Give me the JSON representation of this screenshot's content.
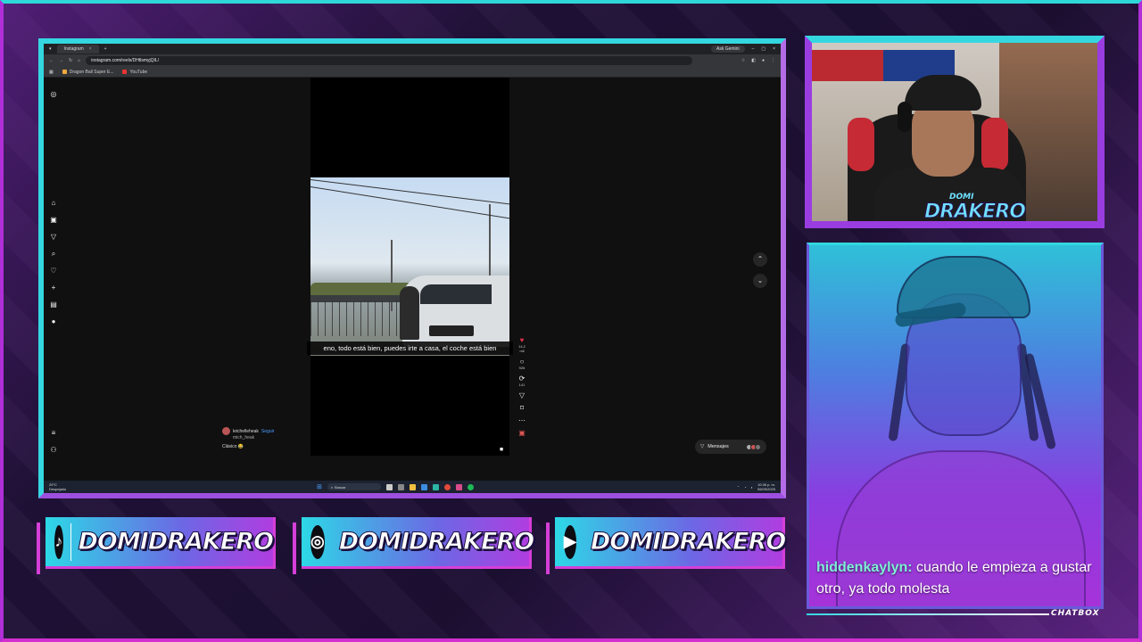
{
  "browser": {
    "tab_title": "Instagram",
    "ask_gemini": "Ask Gemini",
    "url": "instagram.com/reels/DHtlsmyjQIL/",
    "bookmarks": [
      "Dragon Ball Super E...",
      "YouTube"
    ]
  },
  "reel": {
    "subtitle": "eno, todo está bien, puedes irte a casa, el coche está bien",
    "author": "leichelleheak",
    "follow_label": "Seguir",
    "audio": "mich_heak",
    "caption": "Clásico 😂",
    "likes": "14,2 mil",
    "comments": "926",
    "shares": "141"
  },
  "messages_label": "Mensajes",
  "taskbar": {
    "weather_temp": "29°C",
    "weather_desc": "Despejado",
    "search_placeholder": "Buscar",
    "time": "10:36 p. m.",
    "date": "06/09/2025"
  },
  "cam": {
    "logo_top": "DOMI",
    "logo": "DRAKERO"
  },
  "chat": {
    "username": "hiddenkaylyn:",
    "message": " cuando le empieza a gustar otro, ya todo molesta",
    "label": "CHATBOX"
  },
  "socials": [
    {
      "network": "tiktok-icon",
      "handle": "DOMIDRAKERO"
    },
    {
      "network": "instagram-icon",
      "handle": "DOMIDRAKERO"
    },
    {
      "network": "youtube-icon",
      "handle": "DOMIDRAKERO"
    }
  ],
  "colors": {
    "accent_cyan": "#34d7e0",
    "accent_purple": "#b02fd8",
    "chat_username": "#7ff0d6"
  }
}
